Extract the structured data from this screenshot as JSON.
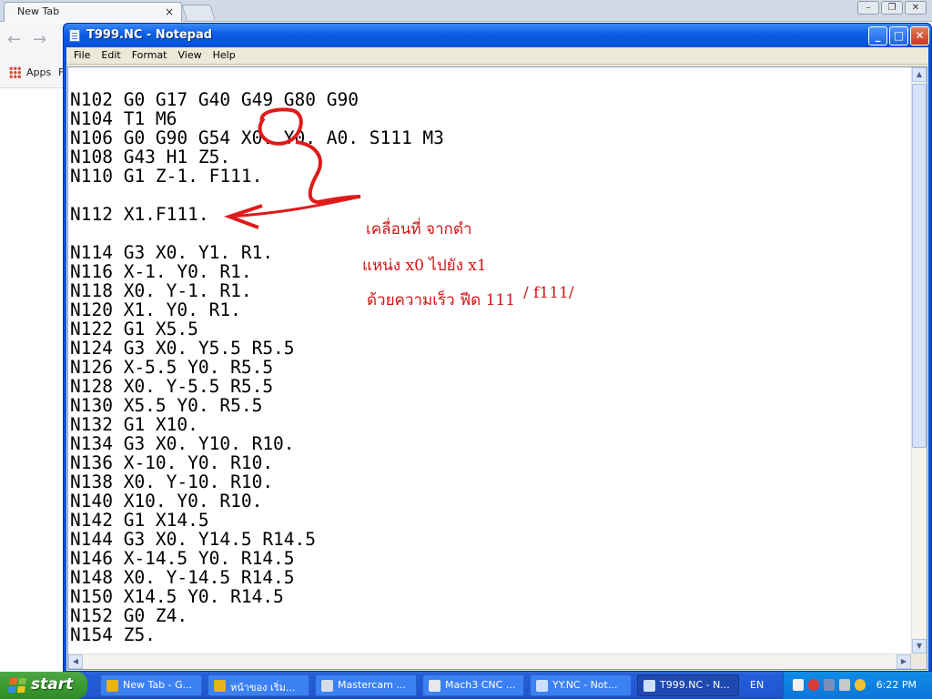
{
  "browser": {
    "tab_title": "New Tab",
    "tab_close": "×",
    "bookmarks_apps": "Apps",
    "bookmarks_more": "F"
  },
  "notepad": {
    "title": "T999.NC - Notepad",
    "menu": [
      "File",
      "Edit",
      "Format",
      "View",
      "Help"
    ],
    "lines": [
      "",
      "N102 G0 G17 G40 G49 G80 G90",
      "N104 T1 M6",
      "N106 G0 G90 G54 X0. Y0. A0. S111 M3",
      "N108 G43 H1 Z5.",
      "N110 G1 Z-1. F111.",
      "",
      "N112 X1.F111.",
      "",
      "N114 G3 X0. Y1. R1.",
      "N116 X-1. Y0. R1.",
      "N118 X0. Y-1. R1.",
      "N120 X1. Y0. R1.",
      "N122 G1 X5.5",
      "N124 G3 X0. Y5.5 R5.5",
      "N126 X-5.5 Y0. R5.5",
      "N128 X0. Y-5.5 R5.5",
      "N130 X5.5 Y0. R5.5",
      "N132 G1 X10.",
      "N134 G3 X0. Y10. R10.",
      "N136 X-10. Y0. R10.",
      "N138 X0. Y-10. R10.",
      "N140 X10. Y0. R10.",
      "N142 G1 X14.5",
      "N144 G3 X0. Y14.5 R14.5",
      "N146 X-14.5 Y0. R14.5",
      "N148 X0. Y-14.5 R14.5",
      "N150 X14.5 Y0. R14.5",
      "N152 G0 Z4.",
      "N154 Z5."
    ],
    "annotation": {
      "line1": "เคลื่อนที่ จากตำ",
      "line2": "แหน่ง x0 ไปยัง x1",
      "line3": "ด้วยความเร็ว ฟีด 111",
      "line3_extra": "/ f111/",
      "color": "#d21414"
    }
  },
  "taskbar": {
    "start_label": "start",
    "tasks": [
      {
        "label": "New Tab - G...",
        "icon": "chrome-icon",
        "color": "#e8b21a"
      },
      {
        "label": "หน้าของ เริ่ม...",
        "icon": "chrome-icon",
        "color": "#e8b21a"
      },
      {
        "label": "Mastercam ...",
        "icon": "mastercam-icon",
        "color": "#d7dde8"
      },
      {
        "label": "Mach3 CNC ...",
        "icon": "mach3-icon",
        "color": "#e8e8e8"
      },
      {
        "label": "YY.NC - Not...",
        "icon": "notepad-icon",
        "color": "#cfe0ff"
      },
      {
        "label": "T999.NC - N...",
        "icon": "notepad-icon",
        "color": "#cfe0ff",
        "active": true
      }
    ],
    "language": "EN",
    "clock": "6:22 PM"
  }
}
